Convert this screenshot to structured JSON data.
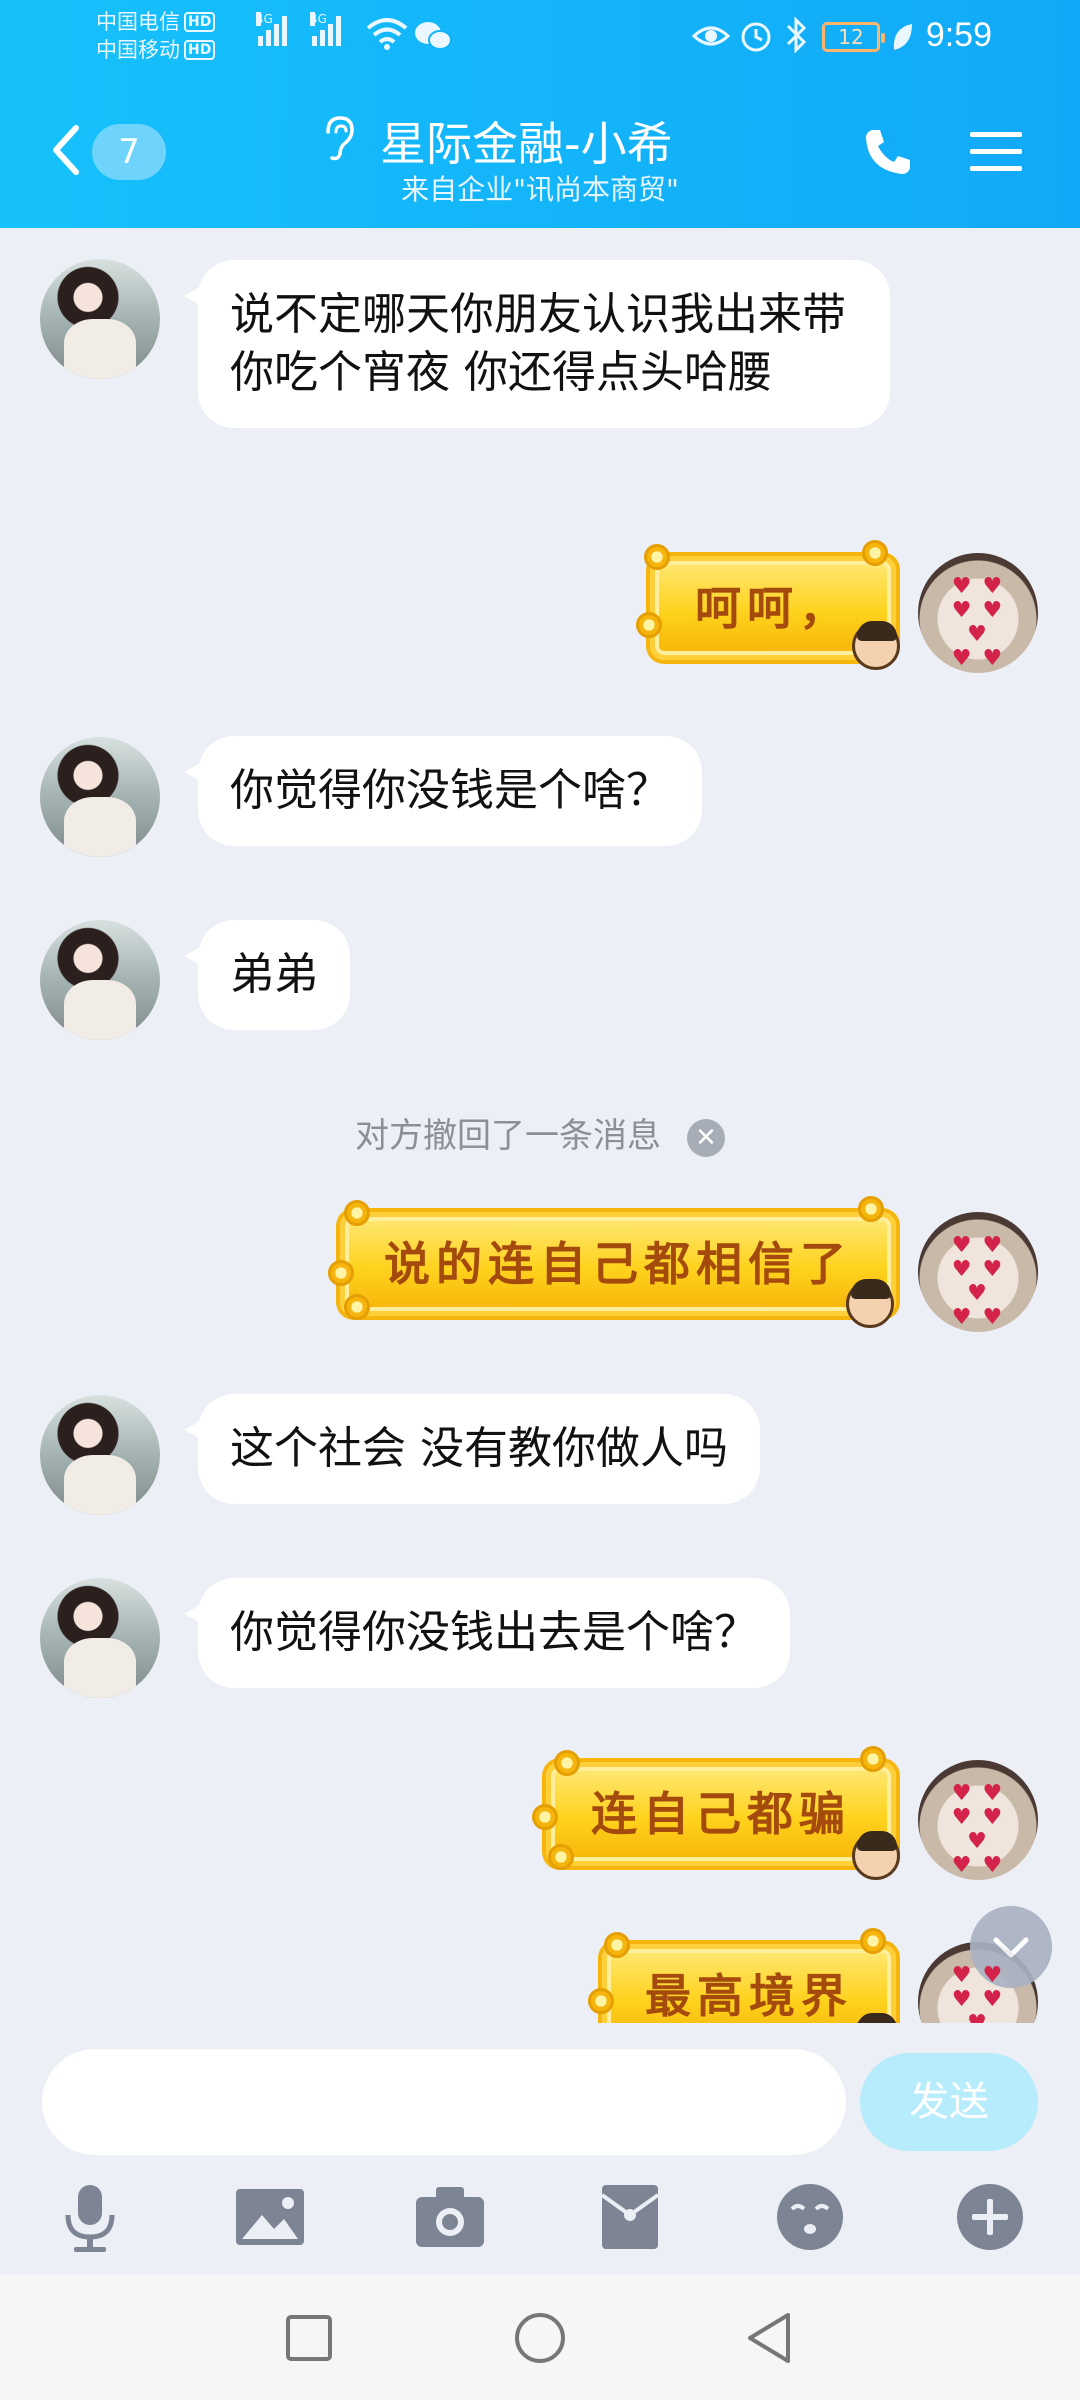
{
  "status_bar": {
    "carrier1": "中国电信",
    "carrier2": "中国移动",
    "hd": "HD",
    "net1": "4G",
    "net2": "4G",
    "battery": "12",
    "time": "9:59"
  },
  "header": {
    "unread_count": "7",
    "title": "星际金融-小希",
    "subtitle": "来自企业\"讯尚本商贸\""
  },
  "messages": [
    {
      "side": "left",
      "type": "text",
      "text": "说不定哪天你朋友认识我出来带你吃个宵夜 你还得点头哈腰"
    },
    {
      "side": "right",
      "type": "sticker",
      "text": "呵呵，"
    },
    {
      "side": "left",
      "type": "text",
      "text": "你觉得你没钱是个啥？"
    },
    {
      "side": "left",
      "type": "text",
      "text": "弟弟"
    },
    {
      "side": "right",
      "type": "sticker",
      "text": "说的连自己都相信了"
    },
    {
      "side": "left",
      "type": "text",
      "text": "这个社会 没有教你做人吗"
    },
    {
      "side": "left",
      "type": "text",
      "text": "你觉得你没钱出去是个啥？"
    },
    {
      "side": "right",
      "type": "sticker",
      "text": "连自己都骗"
    },
    {
      "side": "right",
      "type": "sticker",
      "text": "最高境界"
    }
  ],
  "recall_notice": "对方撤回了一条消息",
  "input": {
    "value": "",
    "send_label": "发送"
  },
  "toolbar_icons": [
    "microphone-icon",
    "image-icon",
    "camera-icon",
    "red-packet-icon",
    "emoji-icon",
    "plus-icon"
  ],
  "colors": {
    "header_start": "#16c1fb",
    "header_end": "#11a9f7",
    "chat_bg": "#eceff5",
    "send_disabled": "#b6ecfb"
  }
}
